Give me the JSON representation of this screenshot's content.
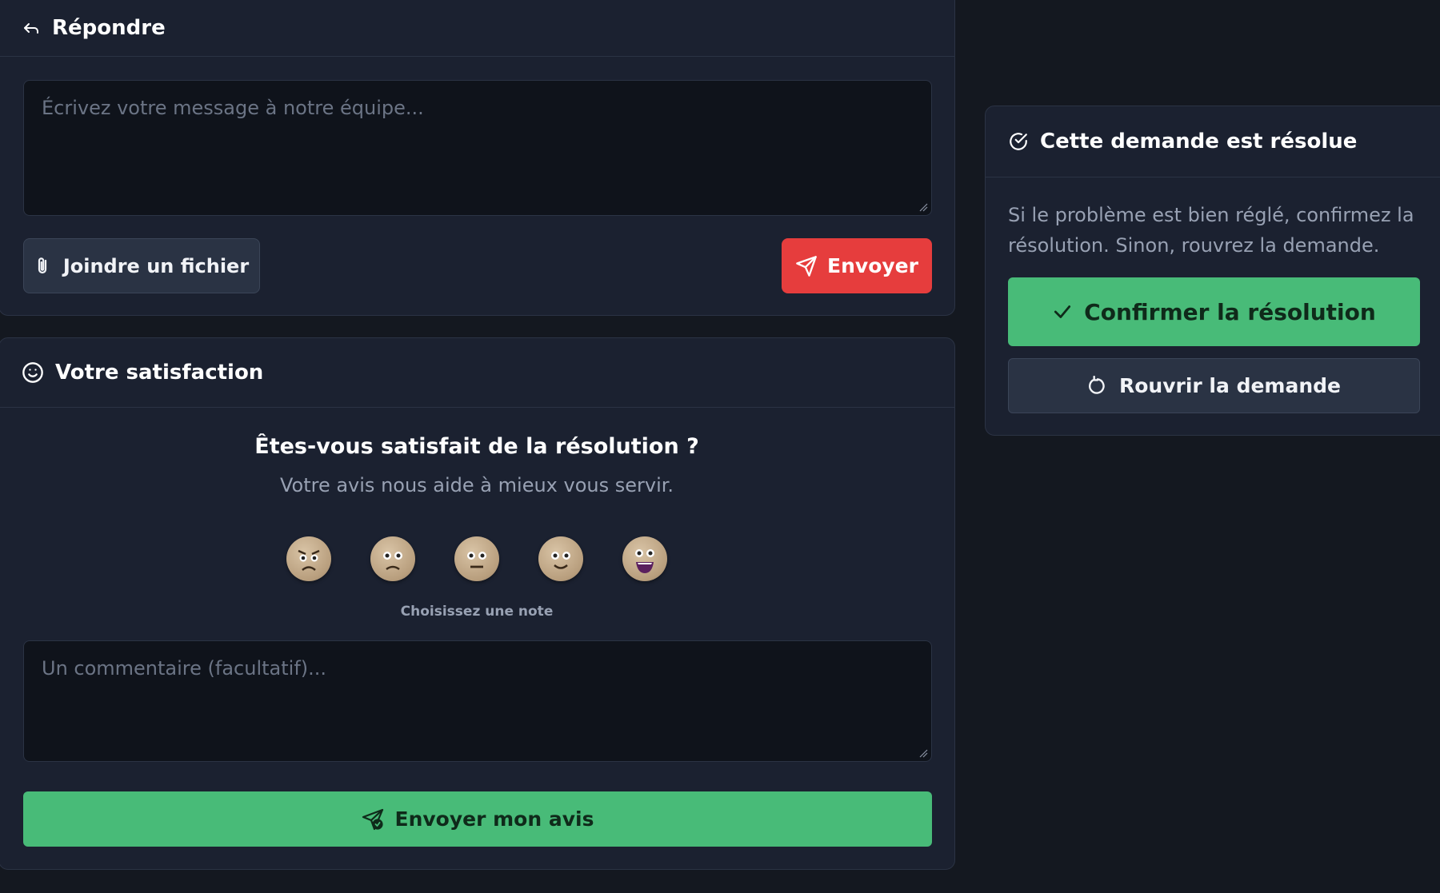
{
  "colors": {
    "background": "#141820",
    "card": "#1b2130",
    "danger": "#e63d3d",
    "success": "#48bb78",
    "muted_text": "#98a1b3"
  },
  "reply": {
    "title": "Répondre",
    "icon": "reply-icon",
    "message_placeholder": "Écrivez votre message à notre équipe...",
    "attach_label": "Joindre un fichier",
    "attach_icon": "paperclip-icon",
    "send_label": "Envoyer",
    "send_icon": "send-icon"
  },
  "satisfaction": {
    "title": "Votre satisfaction",
    "icon": "smile-icon",
    "question": "Êtes-vous satisfait de la résolution ?",
    "subtitle": "Votre avis nous aide à mieux vous servir.",
    "ratings": [
      "very-dissatisfied",
      "dissatisfied",
      "neutral",
      "satisfied",
      "very-satisfied"
    ],
    "rating_hint": "Choisissez une note",
    "comment_placeholder": "Un commentaire (facultatif)...",
    "submit_label": "Envoyer mon avis",
    "submit_icon": "send-check-icon"
  },
  "resolution": {
    "title": "Cette demande est résolue",
    "icon": "check-circle-icon",
    "description": "Si le problème est bien réglé, confirmez la résolution. Sinon, rouvrez la demande.",
    "confirm_label": "Confirmer la résolution",
    "confirm_icon": "check-icon",
    "reopen_label": "Rouvrir la demande",
    "reopen_icon": "rotate-icon"
  }
}
